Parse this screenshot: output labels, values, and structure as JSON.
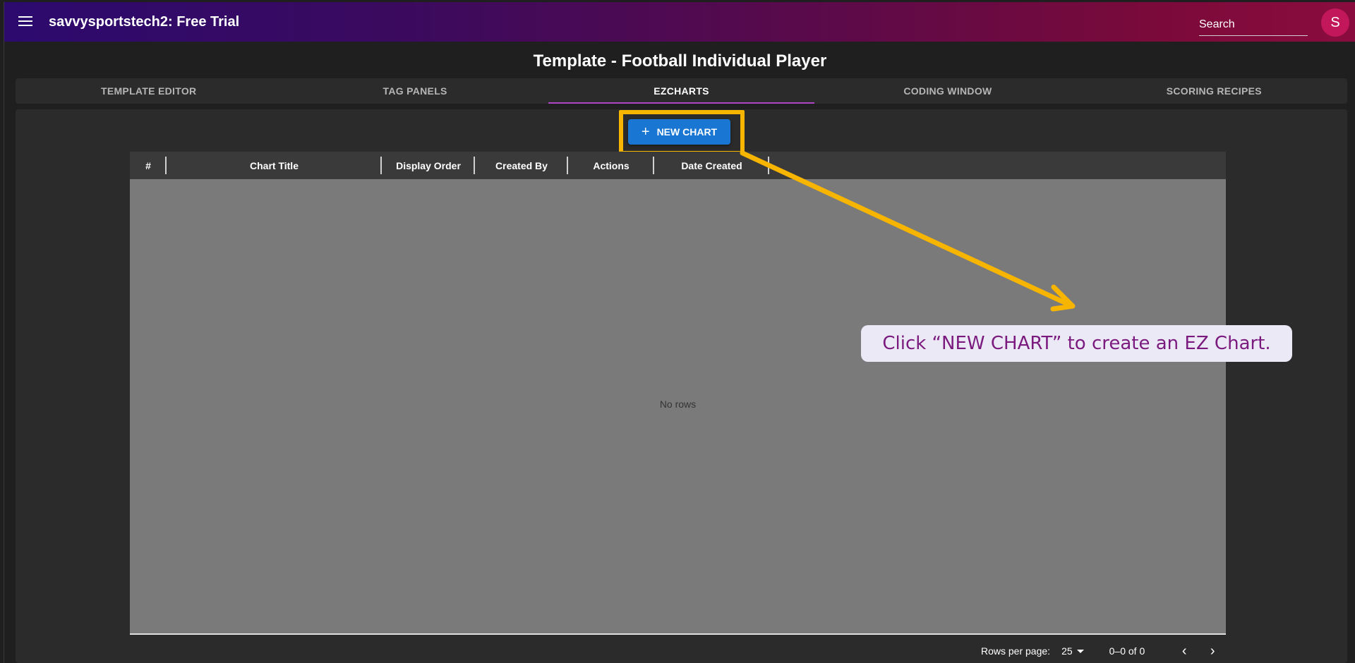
{
  "appbar": {
    "title": "savvysportstech2: Free Trial",
    "search_placeholder": "Search",
    "avatar_letter": "S",
    "gradient_colors": [
      "#2c0a6e",
      "#8a0c3e"
    ]
  },
  "page": {
    "title": "Template - Football Individual Player"
  },
  "tabs": [
    {
      "label": "TEMPLATE EDITOR",
      "active": false
    },
    {
      "label": "TAG PANELS",
      "active": false
    },
    {
      "label": "EZCHARTS",
      "active": true
    },
    {
      "label": "CODING WINDOW",
      "active": false
    },
    {
      "label": "SCORING RECIPES",
      "active": false
    }
  ],
  "toolbar": {
    "new_chart_label": "NEW CHART",
    "new_chart_icon": "plus-icon",
    "accent_color": "#1976d2"
  },
  "grid": {
    "columns": [
      "#",
      "Chart Title",
      "Display Order",
      "Created By",
      "Actions",
      "Date Created"
    ],
    "empty_text": "No rows"
  },
  "pagination": {
    "rows_per_page_label": "Rows per page:",
    "rows_per_page_value": "25",
    "range_text": "0–0 of 0",
    "prev_icon": "chevron-left-icon",
    "next_icon": "chevron-right-icon"
  },
  "annotation": {
    "callout_text": "Click “NEW CHART” to create an EZ Chart.",
    "highlight_color": "#f8b500",
    "callout_text_color": "#7b1a7e"
  }
}
